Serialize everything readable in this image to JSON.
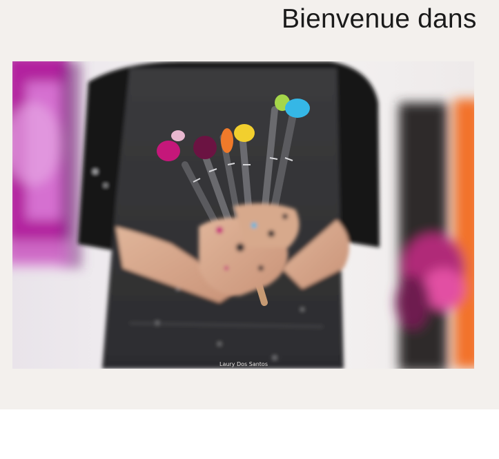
{
  "hero": {
    "heading": "Bienvenue dans",
    "background_color": "#f3f0ed"
  },
  "photo": {
    "credit": "Laury Dos Santos",
    "brush_colors": [
      "#c5177a",
      "#6b1342",
      "#f07a2a",
      "#f2cf2e",
      "#35b7e6",
      "#a5d64a",
      "#e8b7cf"
    ]
  }
}
